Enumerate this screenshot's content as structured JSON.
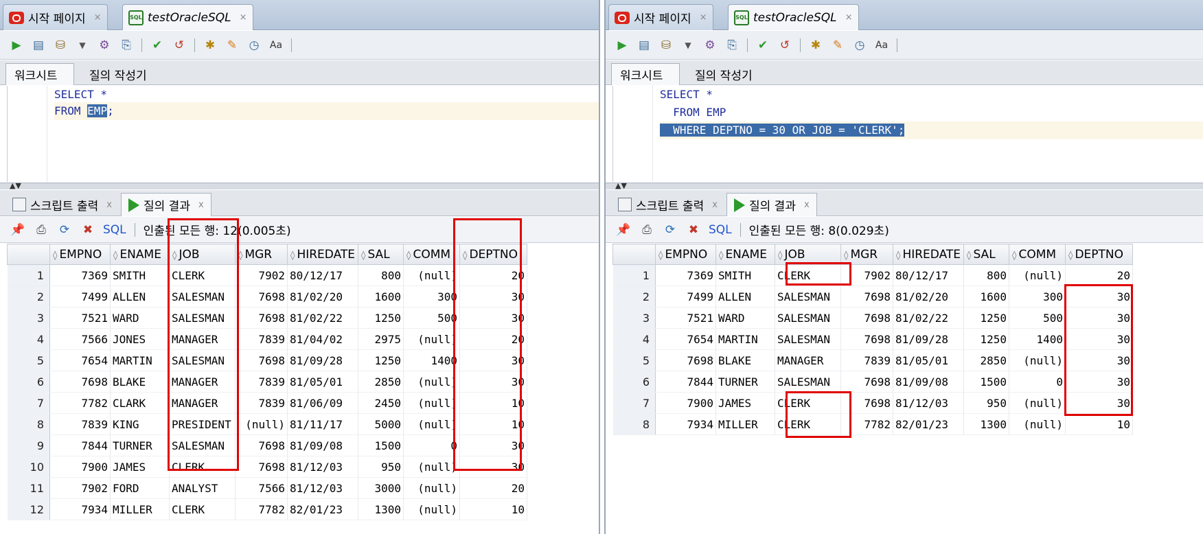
{
  "left": {
    "tabs": [
      {
        "label": "시작 페이지",
        "close": "×"
      },
      {
        "label": "testOracleSQL",
        "close": "×"
      }
    ],
    "subtabs": [
      "워크시트",
      "질의 작성기"
    ],
    "code": {
      "l1_kw": "SELECT",
      "l1_rest": " *",
      "l2_kw": "FROM ",
      "l2_sel": "EMP",
      "l2_rest": ";"
    },
    "result_tabs": [
      {
        "label": "스크립트 출력",
        "close": "x"
      },
      {
        "label": "질의 결과",
        "close": "x"
      }
    ],
    "result_toolbar": {
      "sql": "SQL",
      "status": "인출된 모든 행: 12(0.005초)"
    },
    "columns": [
      "EMPNO",
      "ENAME",
      "JOB",
      "MGR",
      "HIREDATE",
      "SAL",
      "COMM",
      "DEPTNO"
    ],
    "rows": [
      [
        "1",
        "7369",
        "SMITH",
        "CLERK",
        "7902",
        "80/12/17",
        "800",
        "(null)",
        "20"
      ],
      [
        "2",
        "7499",
        "ALLEN",
        "SALESMAN",
        "7698",
        "81/02/20",
        "1600",
        "300",
        "30"
      ],
      [
        "3",
        "7521",
        "WARD",
        "SALESMAN",
        "7698",
        "81/02/22",
        "1250",
        "500",
        "30"
      ],
      [
        "4",
        "7566",
        "JONES",
        "MANAGER",
        "7839",
        "81/04/02",
        "2975",
        "(null)",
        "20"
      ],
      [
        "5",
        "7654",
        "MARTIN",
        "SALESMAN",
        "7698",
        "81/09/28",
        "1250",
        "1400",
        "30"
      ],
      [
        "6",
        "7698",
        "BLAKE",
        "MANAGER",
        "7839",
        "81/05/01",
        "2850",
        "(null)",
        "30"
      ],
      [
        "7",
        "7782",
        "CLARK",
        "MANAGER",
        "7839",
        "81/06/09",
        "2450",
        "(null)",
        "10"
      ],
      [
        "8",
        "7839",
        "KING",
        "PRESIDENT",
        "(null)",
        "81/11/17",
        "5000",
        "(null)",
        "10"
      ],
      [
        "9",
        "7844",
        "TURNER",
        "SALESMAN",
        "7698",
        "81/09/08",
        "1500",
        "0",
        "30"
      ],
      [
        "10",
        "7900",
        "JAMES",
        "CLERK",
        "7698",
        "81/12/03",
        "950",
        "(null)",
        "30"
      ],
      [
        "11",
        "7902",
        "FORD",
        "ANALYST",
        "7566",
        "81/12/03",
        "3000",
        "(null)",
        "20"
      ],
      [
        "12",
        "7934",
        "MILLER",
        "CLERK",
        "7782",
        "82/01/23",
        "1300",
        "(null)",
        "10"
      ]
    ]
  },
  "right": {
    "tabs": [
      {
        "label": "시작 페이지",
        "close": "×"
      },
      {
        "label": "testOracleSQL",
        "close": "×"
      }
    ],
    "subtabs": [
      "워크시트",
      "질의 작성기"
    ],
    "code": {
      "l1_kw": "SELECT",
      "l1_rest": " *",
      "l2": "  FROM EMP",
      "l3_sel": "  WHERE DEPTNO = 30 OR JOB = 'CLERK';"
    },
    "result_tabs": [
      {
        "label": "스크립트 출력",
        "close": "x"
      },
      {
        "label": "질의 결과",
        "close": "x"
      }
    ],
    "result_toolbar": {
      "sql": "SQL",
      "status": "인출된 모든 행: 8(0.029초)"
    },
    "columns": [
      "EMPNO",
      "ENAME",
      "JOB",
      "MGR",
      "HIREDATE",
      "SAL",
      "COMM",
      "DEPTNO"
    ],
    "rows": [
      [
        "1",
        "7369",
        "SMITH",
        "CLERK",
        "7902",
        "80/12/17",
        "800",
        "(null)",
        "20"
      ],
      [
        "2",
        "7499",
        "ALLEN",
        "SALESMAN",
        "7698",
        "81/02/20",
        "1600",
        "300",
        "30"
      ],
      [
        "3",
        "7521",
        "WARD",
        "SALESMAN",
        "7698",
        "81/02/22",
        "1250",
        "500",
        "30"
      ],
      [
        "4",
        "7654",
        "MARTIN",
        "SALESMAN",
        "7698",
        "81/09/28",
        "1250",
        "1400",
        "30"
      ],
      [
        "5",
        "7698",
        "BLAKE",
        "MANAGER",
        "7839",
        "81/05/01",
        "2850",
        "(null)",
        "30"
      ],
      [
        "6",
        "7844",
        "TURNER",
        "SALESMAN",
        "7698",
        "81/09/08",
        "1500",
        "0",
        "30"
      ],
      [
        "7",
        "7900",
        "JAMES",
        "CLERK",
        "7698",
        "81/12/03",
        "950",
        "(null)",
        "30"
      ],
      [
        "8",
        "7934",
        "MILLER",
        "CLERK",
        "7782",
        "82/01/23",
        "1300",
        "(null)",
        "10"
      ]
    ]
  },
  "colors": {
    "highlight": "#e00000",
    "selection": "#3a6aa8",
    "keyword": "#1f2d9c"
  }
}
